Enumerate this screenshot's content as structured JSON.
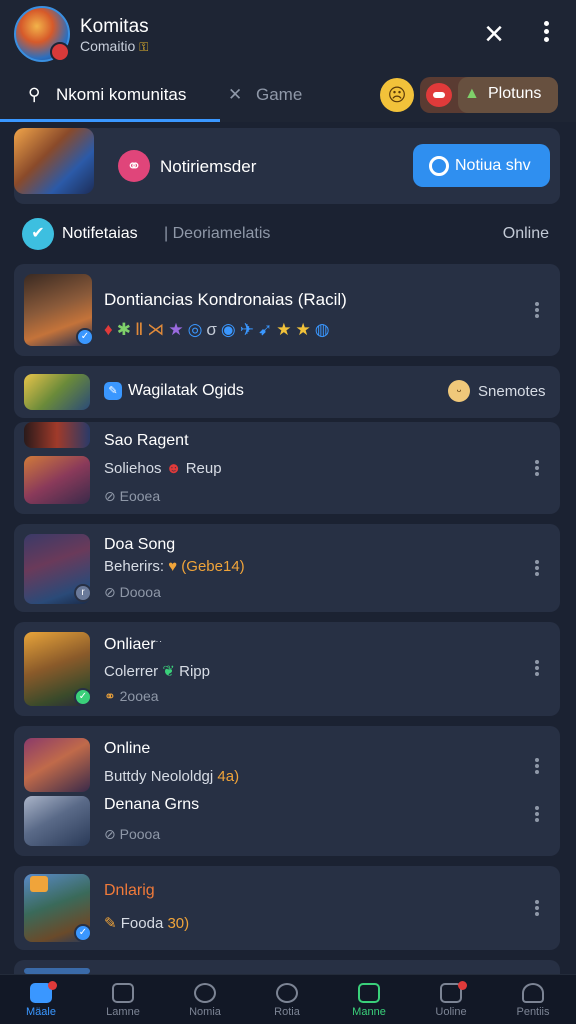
{
  "header": {
    "title": "Komitas",
    "subtitle": "Comaitio"
  },
  "tabs": [
    {
      "label": "Nkomi komunitas",
      "icon": "search-icon",
      "active": true
    },
    {
      "label": "Game",
      "icon": "game-icon",
      "active": false
    }
  ],
  "header_actions": {
    "pill_label": "Plotuns"
  },
  "notification_banner": {
    "text": "Notiriemsder",
    "button_label": "Notiua shv"
  },
  "section": {
    "title": "Notifetaias",
    "subtitle": "Deoriamelatis",
    "status": "Online"
  },
  "featured": {
    "title": "Dontiancias  Kondronaias (Racil)"
  },
  "group_header": {
    "title": "Wagilatak Ogids",
    "right_label": "Snemotes"
  },
  "items": [
    {
      "title": "Sao Ragent",
      "subtitle": "Soliehos",
      "subtitle_tail": "Reup",
      "meta": "Eooea"
    },
    {
      "title": "Doa Song",
      "subtitle": "Beherirs:",
      "subtitle_tail": "(Gebe14)",
      "meta": "Doooa"
    },
    {
      "title": "Onliaer",
      "subtitle": "Colerrer",
      "subtitle_tail": "Ripp",
      "meta": "2ooea"
    },
    {
      "title": "Online",
      "subtitle": "Buttdy Neololdgj",
      "subtitle_tail": "4a)",
      "title2": "Denana Grns",
      "meta": "Poooa"
    },
    {
      "title": "Dnlarig",
      "meta": "Fooda",
      "meta_tail": "30)"
    }
  ],
  "bottom_nav": [
    {
      "label": "Mäale",
      "icon": "home-icon",
      "active": true
    },
    {
      "label": "Lamne",
      "icon": "image-icon"
    },
    {
      "label": "Nomia",
      "icon": "dial-icon"
    },
    {
      "label": "Rotia",
      "icon": "timer-icon"
    },
    {
      "label": "Manne",
      "icon": "map-pin-icon",
      "green": true
    },
    {
      "label": "Uoline",
      "icon": "calendar-icon"
    },
    {
      "label": "Pentiis",
      "icon": "profile-icon"
    }
  ],
  "colors": {
    "accent": "#3a97ff",
    "background": "#1b2232",
    "card": "#273044",
    "highlight": "#f0a43a"
  }
}
